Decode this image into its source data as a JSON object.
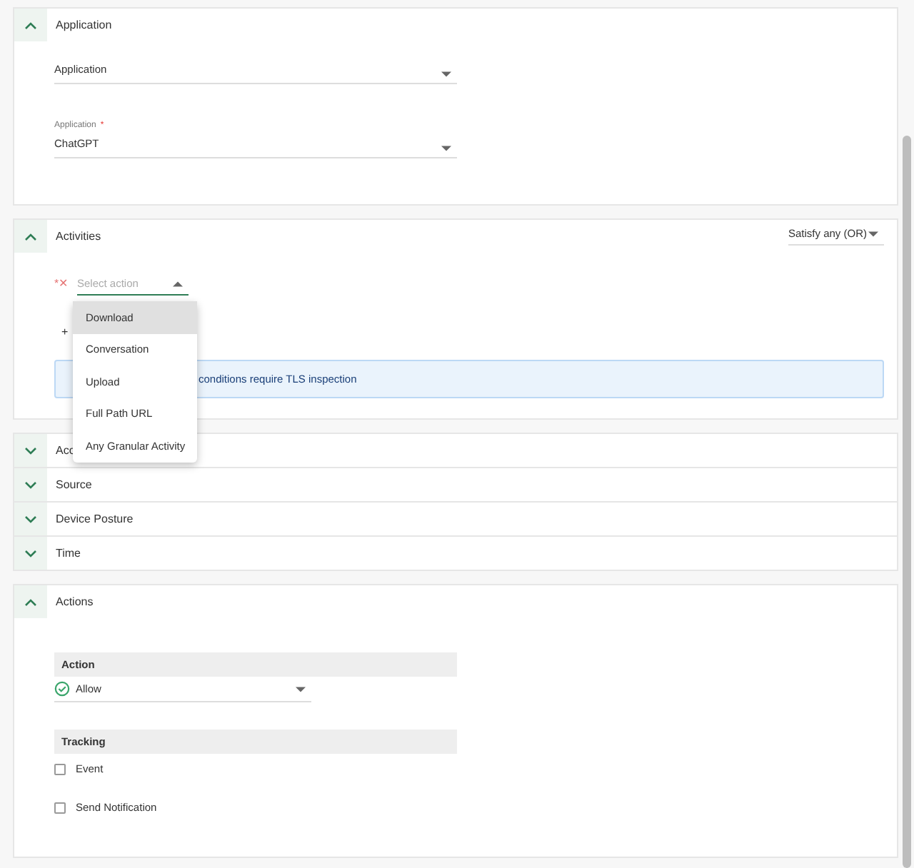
{
  "sections": [
    {
      "kind": "application",
      "title": "Application",
      "expanded": true,
      "fields": [
        {
          "value": "Application"
        },
        {
          "label": "Application",
          "required_mark": "*",
          "value": "ChatGPT"
        }
      ]
    },
    {
      "kind": "activities",
      "title": "Activities",
      "expanded": true,
      "match_mode": "Satisfy any (OR)",
      "remove_mark": "*✕",
      "action_select": {
        "placeholder": "Select action",
        "open": true,
        "options": [
          {
            "label": "Download",
            "selected": true
          },
          {
            "label": "Conversation",
            "selected": false
          },
          {
            "label": "Upload",
            "selected": false
          },
          {
            "label": "Full Path URL",
            "selected": false
          },
          {
            "label": "Any Granular Activity",
            "selected": false
          }
        ]
      },
      "add_link": "+",
      "info_banner": "conditions require TLS inspection"
    },
    {
      "kind": "collapsed",
      "title": "Acc",
      "expanded": false
    },
    {
      "kind": "collapsed",
      "title": "Source",
      "expanded": false
    },
    {
      "kind": "collapsed",
      "title": "Device Posture",
      "expanded": false
    },
    {
      "kind": "collapsed",
      "title": "Time",
      "expanded": false
    },
    {
      "kind": "actions",
      "title": "Actions",
      "expanded": true,
      "action_header": "Action",
      "action_value": "Allow",
      "tracking_header": "Tracking",
      "tracking": [
        {
          "label": "Event",
          "checked": false
        },
        {
          "label": "Send Notification",
          "checked": false
        }
      ]
    }
  ]
}
